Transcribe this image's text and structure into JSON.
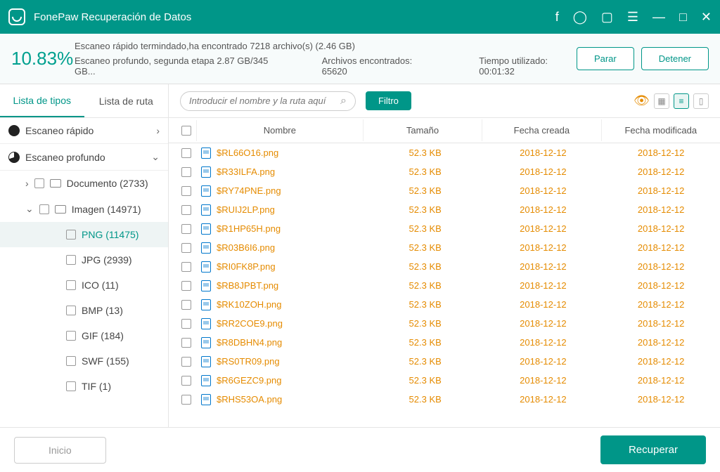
{
  "app_title": "FonePaw Recuperación de Datos",
  "status": {
    "percent": "10.83%",
    "scan_quick": "Escaneo rápido termindado,ha encontrado 7218 archivo(s) (2.46 GB)",
    "scan_deep": "Escaneo profundo, segunda etapa 2.87 GB/345 GB...",
    "files_found": "Archivos encontrados: 65620",
    "elapsed": "Tiempo utilizado: 00:01:32",
    "pause": "Parar",
    "stop": "Detener"
  },
  "tabs": {
    "types": "Lista de tipos",
    "path": "Lista de ruta"
  },
  "tree": {
    "quick": "Escaneo rápido",
    "deep": "Escaneo profundo",
    "documento": "Documento (2733)",
    "imagen": "Imagen (14971)",
    "png": "PNG (11475)",
    "jpg": "JPG (2939)",
    "ico": "ICO (11)",
    "bmp": "BMP (13)",
    "gif": "GIF (184)",
    "swf": "SWF (155)",
    "tif": "TIF (1)"
  },
  "toolbar": {
    "search_placeholder": "Introducir el nombre y la ruta aquí",
    "filter": "Filtro"
  },
  "columns": {
    "name": "Nombre",
    "size": "Tamaño",
    "created": "Fecha creada",
    "modified": "Fecha modificada"
  },
  "files": [
    {
      "name": "$RL66O16.png",
      "size": "52.3 KB",
      "created": "2018-12-12",
      "modified": "2018-12-12"
    },
    {
      "name": "$R33ILFA.png",
      "size": "52.3 KB",
      "created": "2018-12-12",
      "modified": "2018-12-12"
    },
    {
      "name": "$RY74PNE.png",
      "size": "52.3 KB",
      "created": "2018-12-12",
      "modified": "2018-12-12"
    },
    {
      "name": "$RUIJ2LP.png",
      "size": "52.3 KB",
      "created": "2018-12-12",
      "modified": "2018-12-12"
    },
    {
      "name": "$R1HP65H.png",
      "size": "52.3 KB",
      "created": "2018-12-12",
      "modified": "2018-12-12"
    },
    {
      "name": "$R03B6I6.png",
      "size": "52.3 KB",
      "created": "2018-12-12",
      "modified": "2018-12-12"
    },
    {
      "name": "$RI0FK8P.png",
      "size": "52.3 KB",
      "created": "2018-12-12",
      "modified": "2018-12-12"
    },
    {
      "name": "$RB8JPBT.png",
      "size": "52.3 KB",
      "created": "2018-12-12",
      "modified": "2018-12-12"
    },
    {
      "name": "$RK10ZOH.png",
      "size": "52.3 KB",
      "created": "2018-12-12",
      "modified": "2018-12-12"
    },
    {
      "name": "$RR2COE9.png",
      "size": "52.3 KB",
      "created": "2018-12-12",
      "modified": "2018-12-12"
    },
    {
      "name": "$R8DBHN4.png",
      "size": "52.3 KB",
      "created": "2018-12-12",
      "modified": "2018-12-12"
    },
    {
      "name": "$RS0TR09.png",
      "size": "52.3 KB",
      "created": "2018-12-12",
      "modified": "2018-12-12"
    },
    {
      "name": "$R6GEZC9.png",
      "size": "52.3 KB",
      "created": "2018-12-12",
      "modified": "2018-12-12"
    },
    {
      "name": "$RHS53OA.png",
      "size": "52.3 KB",
      "created": "2018-12-12",
      "modified": "2018-12-12"
    }
  ],
  "footer": {
    "home": "Inicio",
    "recover": "Recuperar"
  }
}
